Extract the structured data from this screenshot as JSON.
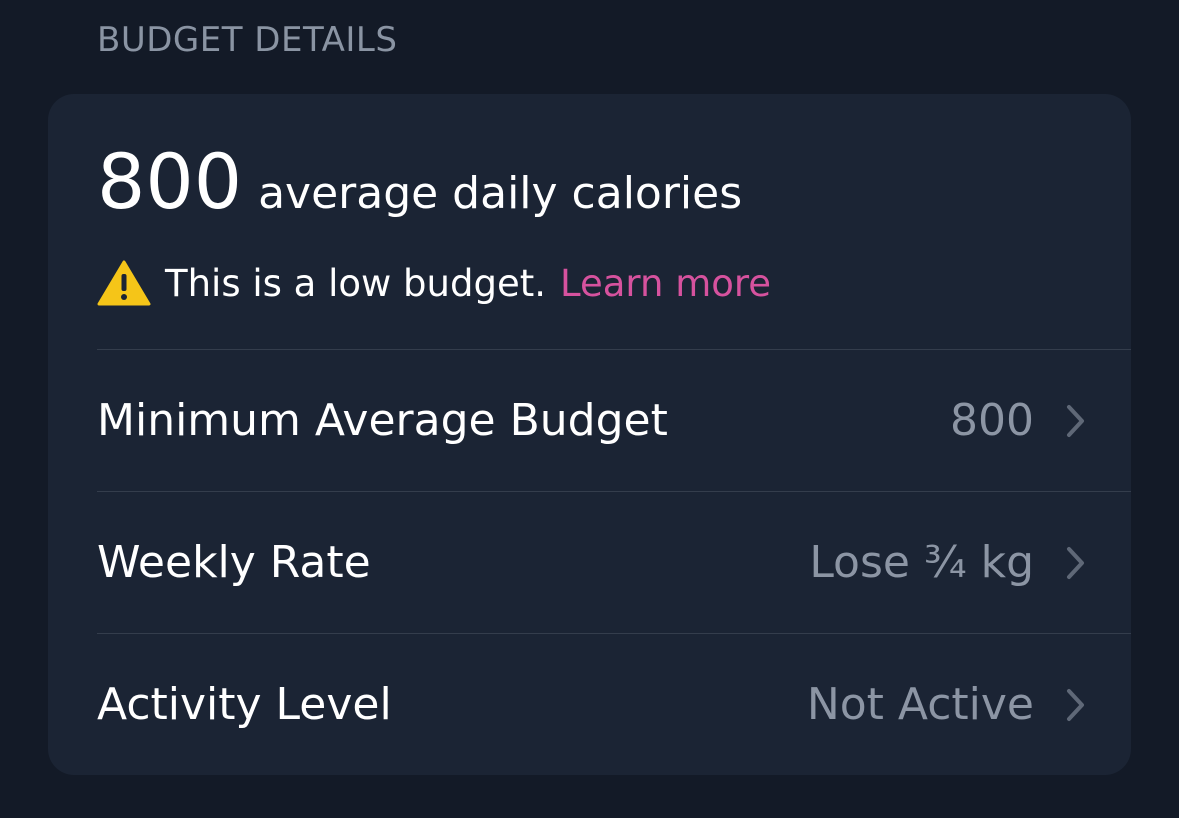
{
  "section": {
    "title": "BUDGET DETAILS"
  },
  "summary": {
    "value": "800",
    "label": "average daily calories"
  },
  "warning": {
    "icon": "warning-icon",
    "text": "This is a low budget.",
    "link_label": "Learn more",
    "link_color": "#d6529e"
  },
  "rows": [
    {
      "label": "Minimum Average Budget",
      "value": "800",
      "icon": "chevron-right-icon"
    },
    {
      "label": "Weekly Rate",
      "value": "Lose ¾ kg",
      "icon": "chevron-right-icon"
    },
    {
      "label": "Activity Level",
      "value": "Not Active",
      "icon": "chevron-right-icon"
    }
  ],
  "colors": {
    "background": "#131a27",
    "card": "#1b2434",
    "accent": "#d6529e",
    "secondary_text": "#8c95a4",
    "warning": "#f5c518"
  }
}
